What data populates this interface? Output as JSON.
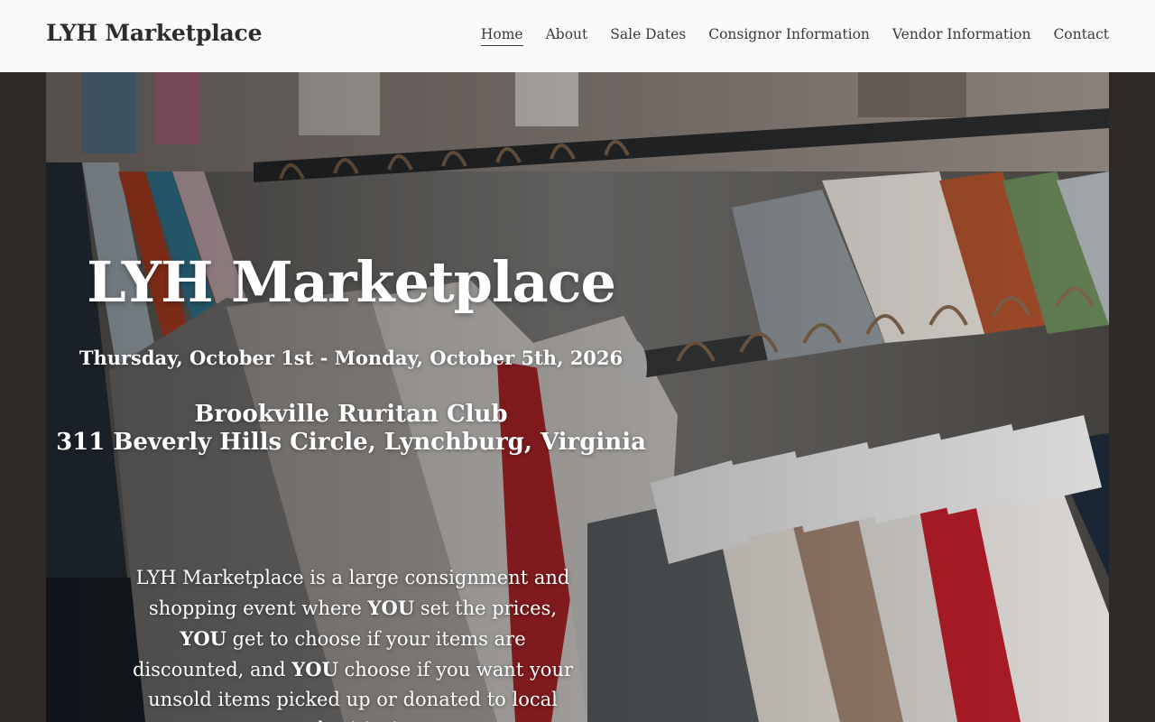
{
  "header": {
    "logo": "LYH Marketplace",
    "nav": [
      {
        "label": "Home",
        "active": true
      },
      {
        "label": "About",
        "active": false
      },
      {
        "label": "Sale Dates",
        "active": false
      },
      {
        "label": "Consignor Information",
        "active": false
      },
      {
        "label": "Vendor Information",
        "active": false
      },
      {
        "label": "Contact",
        "active": false
      }
    ]
  },
  "hero": {
    "title": "LYH Marketplace",
    "dates": "Thursday, October 1st - Monday, October 5th, 2026",
    "venue_name": "Brookville Ruritan Club",
    "venue_address": "311 Beverly Hills Circle, Lynchburg, Virginia",
    "description": {
      "p1": "LYH Marketplace is a large consignment and shopping event where ",
      "em1": "YOU",
      "p2": " set the prices, ",
      "em2": "YOU",
      "p3": " get to choose if your items are discounted, and ",
      "em3": "YOU",
      "p4": " choose if you want your unsold items picked up or donated to local charities!"
    },
    "background_image": "clothing-rack-photo"
  },
  "colors": {
    "header_bg": "#fafafa",
    "page_bg": "#2f2a28",
    "text_dark": "#2c2c2c",
    "hero_text": "#ffffff"
  }
}
